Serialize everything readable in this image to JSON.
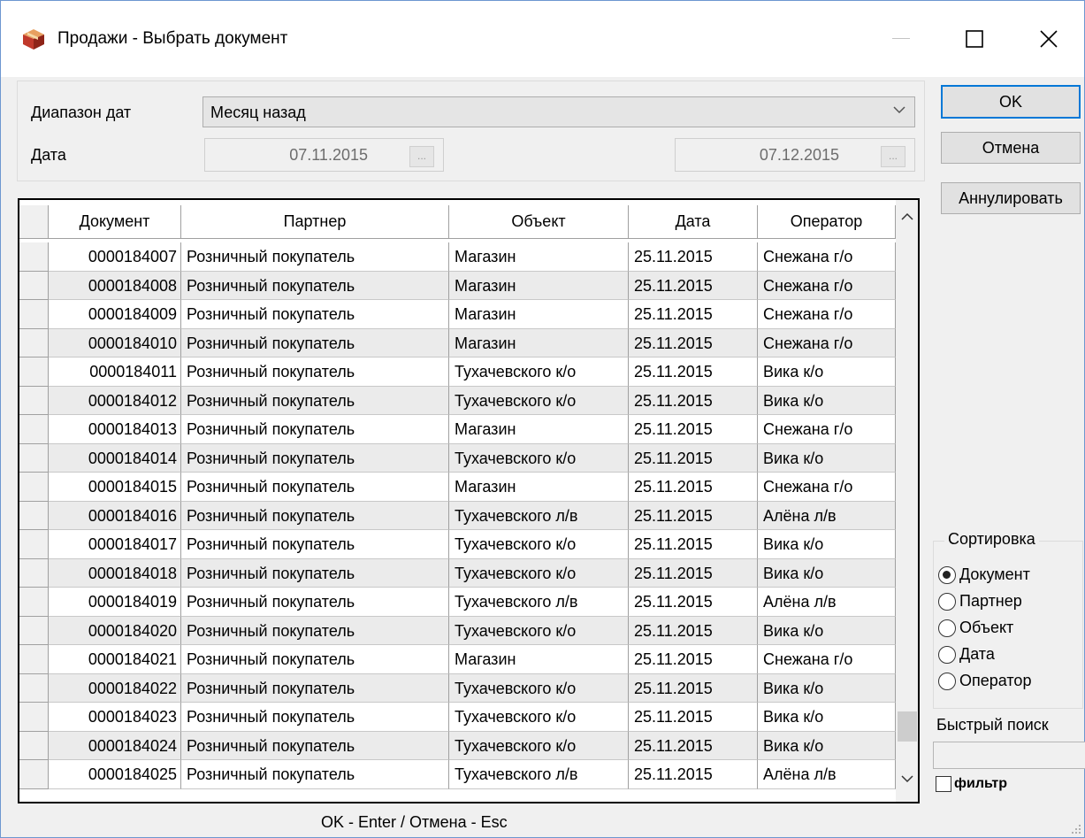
{
  "window": {
    "title": "Продажи - Выбрать документ",
    "controls": [
      "minimize",
      "maximize",
      "close"
    ]
  },
  "filter": {
    "range_label": "Диапазон дат",
    "range_value": "Месяц назад",
    "date_label": "Дата",
    "date_from": "07.11.2015",
    "date_to": "07.12.2015",
    "ellipsis": "..."
  },
  "buttons": {
    "ok": "OK",
    "cancel": "Отмена",
    "annul": "Аннулировать"
  },
  "table": {
    "columns": [
      "Документ",
      "Партнер",
      "Объект",
      "Дата",
      "Оператор"
    ],
    "rows": [
      [
        "0000184007",
        "Розничный покупатель",
        "Магазин",
        "25.11.2015",
        "Снежана г/о"
      ],
      [
        "0000184008",
        "Розничный покупатель",
        "Магазин",
        "25.11.2015",
        "Снежана г/о"
      ],
      [
        "0000184009",
        "Розничный покупатель",
        "Магазин",
        "25.11.2015",
        "Снежана г/о"
      ],
      [
        "0000184010",
        "Розничный покупатель",
        "Магазин",
        "25.11.2015",
        "Снежана г/о"
      ],
      [
        "0000184011",
        "Розничный покупатель",
        "Тухачевского к/о",
        "25.11.2015",
        "Вика к/о"
      ],
      [
        "0000184012",
        "Розничный покупатель",
        "Тухачевского к/о",
        "25.11.2015",
        "Вика к/о"
      ],
      [
        "0000184013",
        "Розничный покупатель",
        "Магазин",
        "25.11.2015",
        "Снежана г/о"
      ],
      [
        "0000184014",
        "Розничный покупатель",
        "Тухачевского к/о",
        "25.11.2015",
        "Вика к/о"
      ],
      [
        "0000184015",
        "Розничный покупатель",
        "Магазин",
        "25.11.2015",
        "Снежана г/о"
      ],
      [
        "0000184016",
        "Розничный покупатель",
        "Тухачевского л/в",
        "25.11.2015",
        "Алёна л/в"
      ],
      [
        "0000184017",
        "Розничный покупатель",
        "Тухачевского к/о",
        "25.11.2015",
        "Вика к/о"
      ],
      [
        "0000184018",
        "Розничный покупатель",
        "Тухачевского к/о",
        "25.11.2015",
        "Вика к/о"
      ],
      [
        "0000184019",
        "Розничный покупатель",
        "Тухачевского л/в",
        "25.11.2015",
        "Алёна л/в"
      ],
      [
        "0000184020",
        "Розничный покупатель",
        "Тухачевского к/о",
        "25.11.2015",
        "Вика к/о"
      ],
      [
        "0000184021",
        "Розничный покупатель",
        "Магазин",
        "25.11.2015",
        "Снежана г/о"
      ],
      [
        "0000184022",
        "Розничный покупатель",
        "Тухачевского к/о",
        "25.11.2015",
        "Вика к/о"
      ],
      [
        "0000184023",
        "Розничный покупатель",
        "Тухачевского к/о",
        "25.11.2015",
        "Вика к/о"
      ],
      [
        "0000184024",
        "Розничный покупатель",
        "Тухачевского к/о",
        "25.11.2015",
        "Вика к/о"
      ],
      [
        "0000184025",
        "Розничный покупатель",
        "Тухачевского л/в",
        "25.11.2015",
        "Алёна л/в"
      ]
    ]
  },
  "sort": {
    "title": "Сортировка",
    "options": [
      "Документ",
      "Партнер",
      "Объект",
      "Дата",
      "Оператор"
    ],
    "selected": "Документ"
  },
  "quick_search": {
    "label": "Быстрый поиск",
    "value": ""
  },
  "filter_checkbox": {
    "label": "фильтр",
    "checked": false
  },
  "hint": "OK - Enter / Отмена - Esc",
  "colors": {
    "window_border": "#6d97d0",
    "ok_focus": "#0078d7",
    "alt_row": "#ebebeb"
  }
}
